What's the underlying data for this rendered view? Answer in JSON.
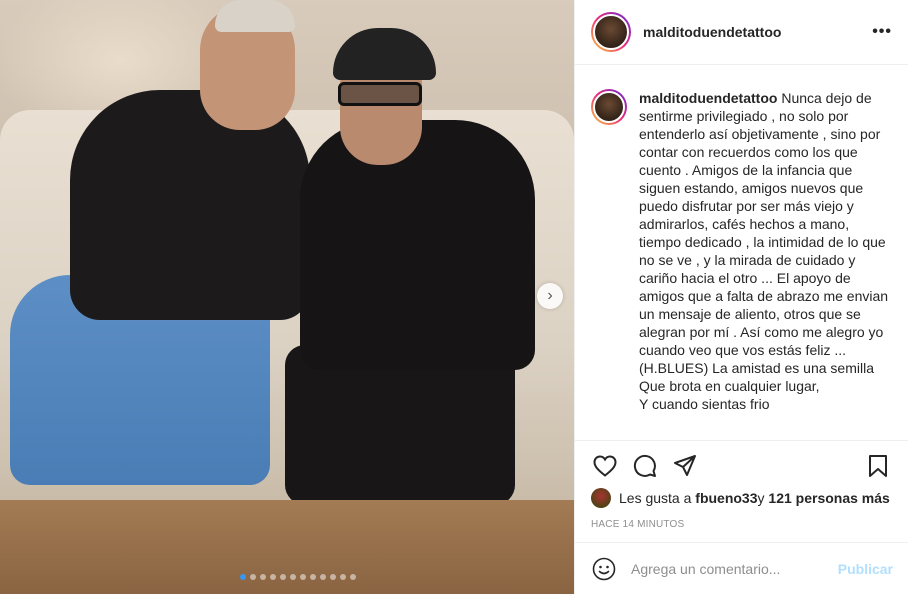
{
  "post": {
    "username": "malditoduendetattoo",
    "more_label": "•••",
    "caption_user": "malditoduendetattoo",
    "caption_text": " Nunca dejo de sentirme privilegiado , no solo por entenderlo así objetivamente , sino por contar con recuerdos como los que cuento . Amigos de la infancia que siguen estando, amigos nuevos que puedo disfrutar por ser más viejo y admirarlos, cafés hechos a mano, tiempo dedicado , la intimidad de lo que no se ve , y la mirada de cuidado y cariño hacia el otro ... El apoyo de amigos que a falta de abrazo me envian un mensaje de aliento, otros que se alegran por mí . Así como me alegro yo cuando veo que vos estás feliz ...\n(H.BLUES) La amistad es una semilla\nQue brota en cualquier lugar,\nY cuando sientas frio",
    "likes_prefix": "Les gusta a ",
    "likes_user": "fbueno33",
    "likes_middle": " y ",
    "likes_count": "121 personas más",
    "time": "HACE 14 MINUTOS",
    "comment_placeholder": "Agrega un comentario...",
    "publish_label": "Publicar",
    "carousel_next": "›",
    "carousel_active_index": 0
  },
  "icons": {
    "like": "heart-icon",
    "comment": "comment-icon",
    "share": "send-icon",
    "save": "bookmark-icon",
    "emoji": "smiley-icon"
  },
  "colors": {
    "accent_dot": "#3897f0",
    "publish_disabled": "#b2dffc",
    "meta_gray": "#8e8e8e"
  }
}
